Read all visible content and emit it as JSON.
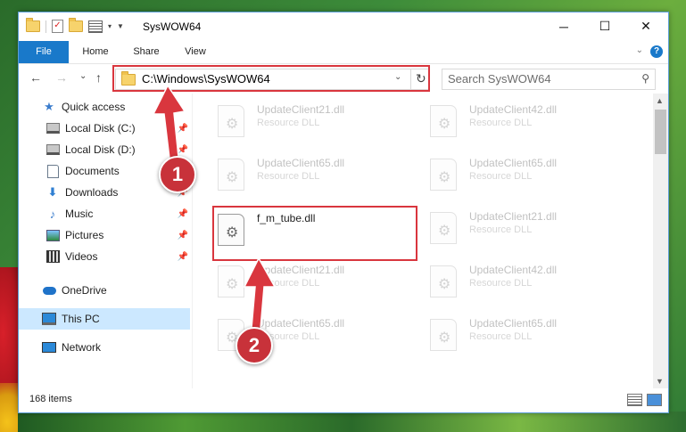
{
  "window": {
    "title": "SysWOW64"
  },
  "titlebar": {
    "minimize": "─",
    "maximize": "☐",
    "close": "✕"
  },
  "ribbon": {
    "tabs": [
      "File",
      "Home",
      "Share",
      "View"
    ],
    "help": "?"
  },
  "nav": {
    "back": "←",
    "forward": "→",
    "recent": "⌄",
    "up": "↑",
    "address": "C:\\Windows\\SysWOW64",
    "search_placeholder": "Search SysWOW64"
  },
  "sidebar": {
    "items": [
      {
        "label": "Quick access",
        "icon": "star-icon"
      },
      {
        "label": "Local Disk (C:)",
        "icon": "drive-icon",
        "pinned": true
      },
      {
        "label": "Local Disk (D:)",
        "icon": "drive-icon",
        "pinned": true
      },
      {
        "label": "Documents",
        "icon": "documents-icon",
        "pinned": true
      },
      {
        "label": "Downloads",
        "icon": "downloads-icon",
        "pinned": true
      },
      {
        "label": "Music",
        "icon": "music-icon",
        "pinned": true
      },
      {
        "label": "Pictures",
        "icon": "pictures-icon",
        "pinned": true
      },
      {
        "label": "Videos",
        "icon": "videos-icon",
        "pinned": true
      },
      {
        "label": "OneDrive",
        "icon": "onedrive-icon"
      },
      {
        "label": "This PC",
        "icon": "pc-icon",
        "selected": true
      },
      {
        "label": "Network",
        "icon": "network-icon"
      }
    ]
  },
  "files": [
    {
      "name": "UpdateClient21.dll",
      "desc": "Resource DLL"
    },
    {
      "name": "UpdateClient42.dll",
      "desc": "Resource DLL"
    },
    {
      "name": "UpdateClient65.dll",
      "desc": "Resource DLL"
    },
    {
      "name": "UpdateClient65.dll",
      "desc": "Resource DLL"
    },
    {
      "name": "f_m_tube.dll",
      "desc": "",
      "highlighted": true
    },
    {
      "name": "UpdateClient21.dll",
      "desc": "Resource DLL"
    },
    {
      "name": "UpdateClient21.dll",
      "desc": "Resource DLL"
    },
    {
      "name": "UpdateClient42.dll",
      "desc": "Resource DLL"
    },
    {
      "name": "UpdateClient65.dll",
      "desc": "Resource DLL"
    },
    {
      "name": "UpdateClient65.dll",
      "desc": "Resource DLL"
    }
  ],
  "status": {
    "item_count": "168 items"
  },
  "annotations": {
    "step1": "1",
    "step2": "2",
    "color": "#d9363e"
  }
}
